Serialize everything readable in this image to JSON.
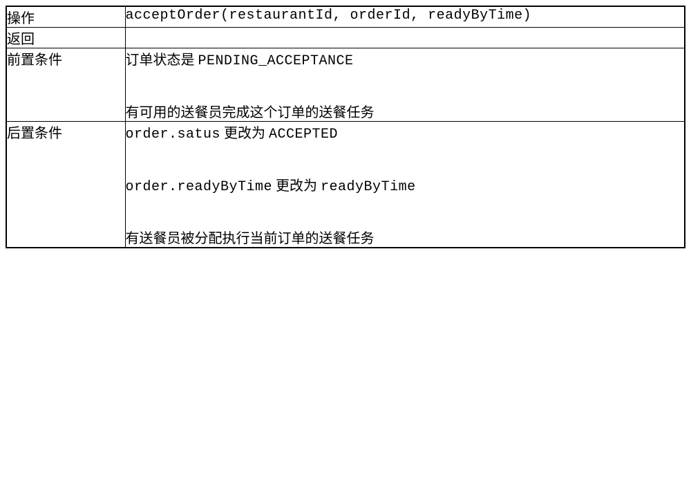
{
  "rows": {
    "operation": {
      "label": "操作",
      "value": "acceptOrder(restaurantId, orderId, readyByTime)"
    },
    "returns": {
      "label": "返回",
      "value": ""
    },
    "precondition": {
      "label": "前置条件",
      "line1_prefix": "订单状态是 ",
      "line1_mono": "PENDING_ACCEPTANCE",
      "line2": "有可用的送餐员完成这个订单的送餐任务"
    },
    "postcondition": {
      "label": "后置条件",
      "line1_mono1": "order.satus",
      "line1_mid": " 更改为 ",
      "line1_mono2": "ACCEPTED",
      "line2_mono1": "order.readyByTime",
      "line2_mid": " 更改为 ",
      "line2_mono2": "readyByTime",
      "line3": "有送餐员被分配执行当前订单的送餐任务"
    }
  }
}
